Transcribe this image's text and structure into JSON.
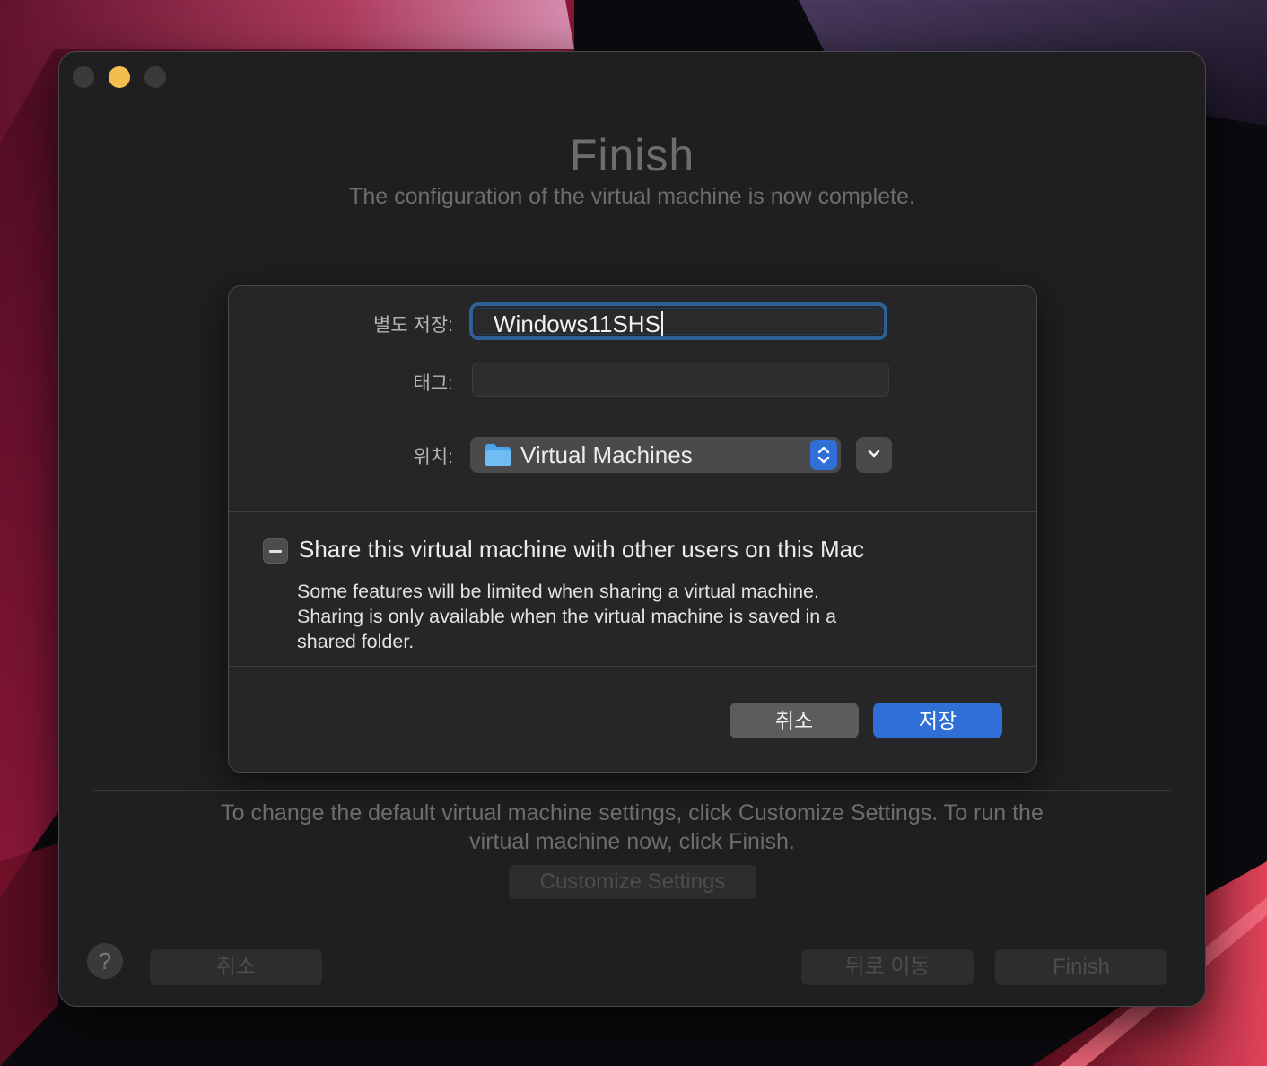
{
  "assistant": {
    "title": "Finish",
    "subtitle": "The configuration of the virtual machine is now complete.",
    "info_lines": [
      "To change the default virtual machine settings, click Customize Settings. To run the",
      "virtual machine now, click Finish."
    ],
    "customize_label": "Customize Settings",
    "help_label": "?",
    "cancel_label": "취소",
    "back_label": "뒤로 이동",
    "finish_label": "Finish"
  },
  "save_sheet": {
    "name_label": "별도 저장:",
    "name_value": "Windows11SHS",
    "tags_label": "태그:",
    "tags_value": "",
    "location_label": "위치:",
    "location_value": "Virtual Machines",
    "share_label": "Share this virtual machine with other users on this Mac",
    "share_desc_lines": [
      "Some features will be limited when sharing a virtual machine.",
      "Sharing is only available when the virtual machine is saved in a",
      "shared folder."
    ],
    "cancel_label": "취소",
    "save_label": "저장"
  },
  "colors": {
    "accent": "#2f6fd6",
    "focus_ring": "#2e5f95",
    "traffic_yellow": "#f4bd4f"
  },
  "icons": {
    "folder": "folder-icon",
    "stepper": "up-down-chevron-icon",
    "expand": "chevron-down-icon",
    "checkbox_state": "mixed-dash-icon"
  }
}
